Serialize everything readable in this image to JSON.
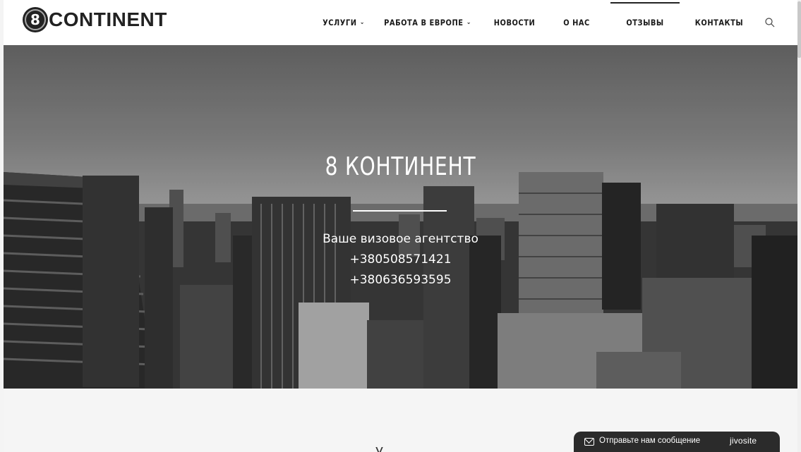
{
  "logo": {
    "digit": "8",
    "text": "CONTINENT"
  },
  "nav": {
    "items": [
      {
        "label": "УСЛУГИ",
        "has_dropdown": true
      },
      {
        "label": "РАБОТА В ЕВРОПЕ",
        "has_dropdown": true
      },
      {
        "label": "НОВОСТИ",
        "has_dropdown": false
      },
      {
        "label": "О НАС",
        "has_dropdown": false
      },
      {
        "label": "ОТЗЫВЫ",
        "has_dropdown": false,
        "active": true
      },
      {
        "label": "КОНТАКТЫ",
        "has_dropdown": false
      }
    ],
    "dropdown_icon": "chevron-down-icon",
    "search_icon": "search-icon"
  },
  "hero": {
    "title": "8 КОНТИНЕНТ",
    "subtitle": "Ваше визовое агентство",
    "phones": [
      "+380508571421",
      "+380636593595"
    ]
  },
  "below": {
    "heading_fragment": "У"
  },
  "chat": {
    "text": "Отправьте нам сообщение",
    "brand": "jivosite",
    "icon": "envelope-icon"
  },
  "colors": {
    "header_bg": "#ffffff",
    "text_dark": "#1a1a1a",
    "chat_bg": "#2b2b2b",
    "hero_text": "#ffffff"
  }
}
